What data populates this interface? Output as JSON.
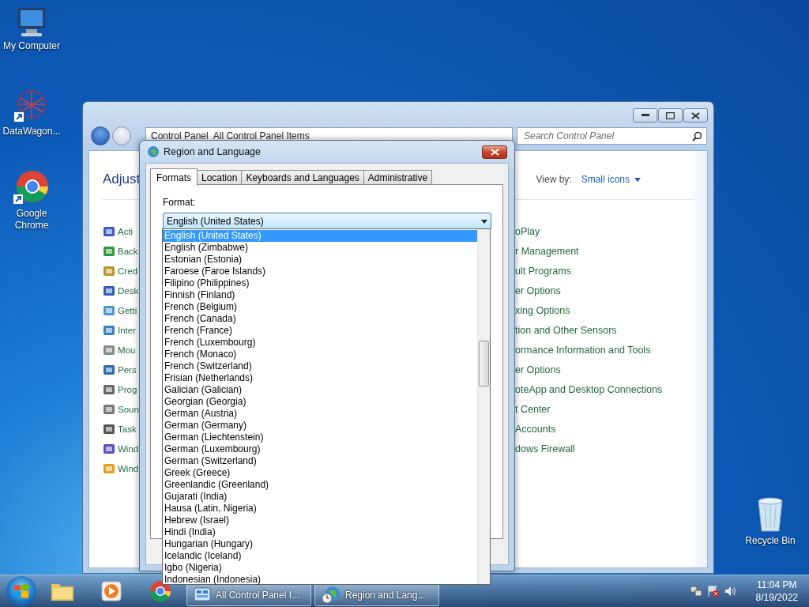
{
  "desktop_icons": [
    {
      "label": "My Computer",
      "kind": "computer"
    },
    {
      "label": "DataWagon...",
      "kind": "shortcut"
    },
    {
      "label": "Google Chrome",
      "kind": "browser"
    }
  ],
  "recycle_bin": {
    "label": "Recycle Bin"
  },
  "control_panel": {
    "address": [
      "Control Panel",
      "All Control Panel Items"
    ],
    "search": {
      "placeholder": "Search Control Panel"
    },
    "heading": "Adjust",
    "view_by_label": "View by:",
    "view_by_value": "Small icons",
    "left_items": [
      "Acti",
      "Back",
      "Cred",
      "Desk",
      "Getti",
      "Inter",
      "Mou",
      "Pers",
      "Prog",
      "Soun",
      "Task",
      "Wind",
      "Wind"
    ],
    "right_items": [
      "oPlay",
      "r Management",
      "ult Programs",
      "er Options",
      "xing Options",
      "tion and Other Sensors",
      "ormance Information and Tools",
      "er Options",
      "oteApp and Desktop Connections",
      "t Center",
      "Accounts",
      "dows Firewall"
    ]
  },
  "dialog": {
    "title": "Region and Language",
    "tabs": [
      {
        "label": "Formats",
        "selected": true
      },
      {
        "label": "Location",
        "selected": false
      },
      {
        "label": "Keyboards and Languages",
        "selected": false
      },
      {
        "label": "Administrative",
        "selected": false
      }
    ],
    "format_label": "Format:",
    "format_value": "English (United States)",
    "options": [
      {
        "label": "English (United States)",
        "selected": true
      },
      {
        "label": "English (Zimbabwe)",
        "selected": false
      },
      {
        "label": "Estonian (Estonia)",
        "selected": false
      },
      {
        "label": "Faroese (Faroe Islands)",
        "selected": false
      },
      {
        "label": "Filipino (Philippines)",
        "selected": false
      },
      {
        "label": "Finnish (Finland)",
        "selected": false
      },
      {
        "label": "French (Belgium)",
        "selected": false
      },
      {
        "label": "French (Canada)",
        "selected": false
      },
      {
        "label": "French (France)",
        "selected": false
      },
      {
        "label": "French (Luxembourg)",
        "selected": false
      },
      {
        "label": "French (Monaco)",
        "selected": false
      },
      {
        "label": "French (Switzerland)",
        "selected": false
      },
      {
        "label": "Frisian (Netherlands)",
        "selected": false
      },
      {
        "label": "Galician (Galician)",
        "selected": false
      },
      {
        "label": "Georgian (Georgia)",
        "selected": false
      },
      {
        "label": "German (Austria)",
        "selected": false
      },
      {
        "label": "German (Germany)",
        "selected": false
      },
      {
        "label": "German (Liechtenstein)",
        "selected": false
      },
      {
        "label": "German (Luxembourg)",
        "selected": false
      },
      {
        "label": "German (Switzerland)",
        "selected": false
      },
      {
        "label": "Greek (Greece)",
        "selected": false
      },
      {
        "label": "Greenlandic (Greenland)",
        "selected": false
      },
      {
        "label": "Gujarati (India)",
        "selected": false
      },
      {
        "label": "Hausa (Latin, Nigeria)",
        "selected": false
      },
      {
        "label": "Hebrew (Israel)",
        "selected": false
      },
      {
        "label": "Hindi (India)",
        "selected": false
      },
      {
        "label": "Hungarian (Hungary)",
        "selected": false
      },
      {
        "label": "Icelandic (Iceland)",
        "selected": false
      },
      {
        "label": "Igbo (Nigeria)",
        "selected": false
      },
      {
        "label": "Indonesian (Indonesia)",
        "selected": false
      }
    ]
  },
  "taskbar": {
    "buttons": [
      {
        "label": "All Control Panel I...",
        "kind": "control-panel"
      },
      {
        "label": "Region and Lang...",
        "kind": "region"
      }
    ],
    "time": "11:04 PM",
    "date": "8/19/2022"
  }
}
